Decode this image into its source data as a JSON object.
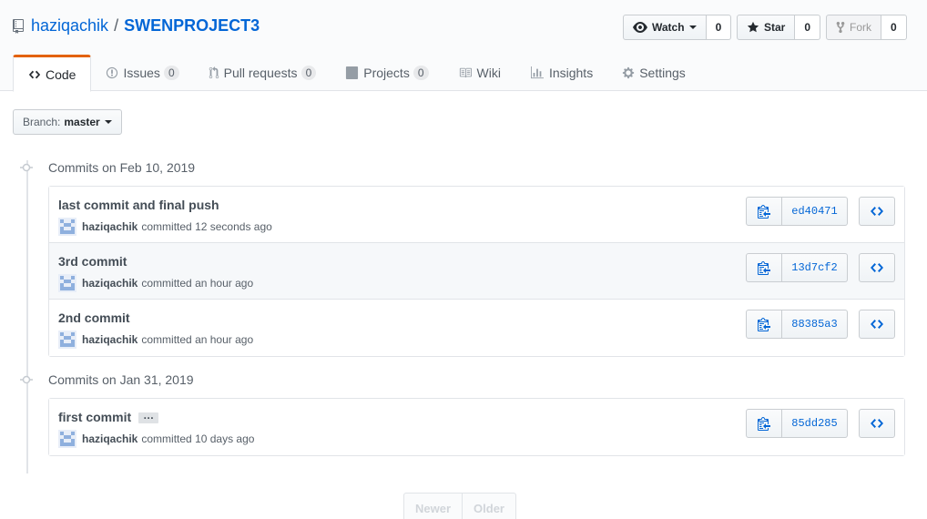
{
  "repo": {
    "owner": "haziqachik",
    "separator": "/",
    "name": "SWENPROJECT3"
  },
  "actions": {
    "watch": {
      "label": "Watch",
      "count": "0"
    },
    "star": {
      "label": "Star",
      "count": "0"
    },
    "fork": {
      "label": "Fork",
      "count": "0"
    }
  },
  "tabs": [
    {
      "label": "Code",
      "icon": "code-icon",
      "selected": true
    },
    {
      "label": "Issues",
      "count": "0",
      "icon": "issue-icon"
    },
    {
      "label": "Pull requests",
      "count": "0",
      "icon": "pull-request-icon"
    },
    {
      "label": "Projects",
      "count": "0",
      "icon": "project-icon"
    },
    {
      "label": "Wiki",
      "icon": "book-icon"
    },
    {
      "label": "Insights",
      "icon": "graph-icon"
    },
    {
      "label": "Settings",
      "icon": "gear-icon"
    }
  ],
  "branch": {
    "label": "Branch:",
    "value": "master"
  },
  "groups": [
    {
      "heading": "Commits on Feb 10, 2019",
      "commits": [
        {
          "title": "last commit and final push",
          "author": "haziqachik",
          "action": "committed",
          "time": "12 seconds ago",
          "sha": "ed40471"
        },
        {
          "title": "3rd commit",
          "author": "haziqachik",
          "action": "committed",
          "time": "an hour ago",
          "sha": "13d7cf2"
        },
        {
          "title": "2nd commit",
          "author": "haziqachik",
          "action": "committed",
          "time": "an hour ago",
          "sha": "88385a3"
        }
      ]
    },
    {
      "heading": "Commits on Jan 31, 2019",
      "commits": [
        {
          "title": "first commit",
          "ellipsis": "…",
          "author": "haziqachik",
          "action": "committed",
          "time": "10 days ago",
          "sha": "85dd285"
        }
      ]
    }
  ],
  "pagination": {
    "newer": "Newer",
    "older": "Older"
  },
  "colors": {
    "link": "#0366d6",
    "tab_accent": "#e36209",
    "row_highlight": "#f6f8fa"
  }
}
